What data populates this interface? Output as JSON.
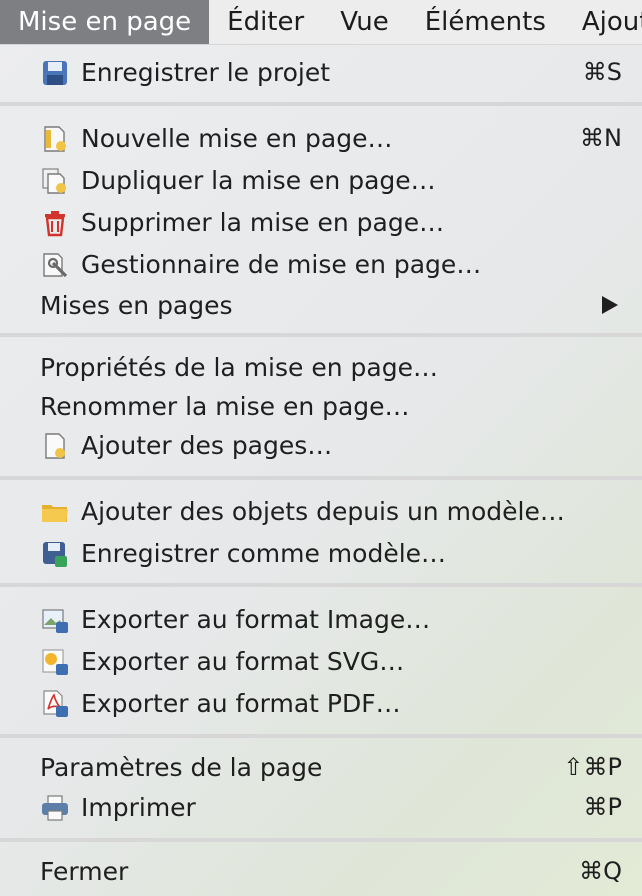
{
  "menubar": {
    "items": [
      "Mise en page",
      "Éditer",
      "Vue",
      "Éléments",
      "Ajout"
    ]
  },
  "menu": {
    "save_project": {
      "label": "Enregistrer le projet",
      "shortcut": "⌘S",
      "icon": "save-icon"
    },
    "new_layout": {
      "label": "Nouvelle mise en page…",
      "shortcut": "⌘N",
      "icon": "new-layout-icon"
    },
    "duplicate_layout": {
      "label": "Dupliquer la mise en page…",
      "icon": "duplicate-layout-icon"
    },
    "delete_layout": {
      "label": "Supprimer la mise en page…",
      "icon": "trash-icon"
    },
    "layout_manager": {
      "label": "Gestionnaire de mise en page…",
      "icon": "layout-manager-icon"
    },
    "layouts": {
      "label": "Mises en pages",
      "icon": "submenu-arrow-icon"
    },
    "layout_properties": {
      "label": "Propriétés de la mise en page…"
    },
    "rename_layout": {
      "label": "Renommer la mise en page…"
    },
    "add_pages": {
      "label": "Ajouter des pages…",
      "icon": "add-pages-icon"
    },
    "add_from_template": {
      "label": "Ajouter des objets depuis un modèle…",
      "icon": "folder-icon"
    },
    "save_as_template": {
      "label": "Enregistrer comme modèle…",
      "icon": "save-template-icon"
    },
    "export_image": {
      "label": "Exporter au format Image…",
      "icon": "export-image-icon"
    },
    "export_svg": {
      "label": "Exporter au format SVG…",
      "icon": "export-svg-icon"
    },
    "export_pdf": {
      "label": "Exporter au format PDF…",
      "icon": "export-pdf-icon"
    },
    "page_setup": {
      "label": "Paramètres de la page",
      "shortcut": "⇧⌘P"
    },
    "print": {
      "label": "Imprimer",
      "shortcut": "⌘P",
      "icon": "printer-icon"
    },
    "close": {
      "label": "Fermer",
      "shortcut": "⌘Q"
    }
  },
  "colors": {
    "active_menu_bg": "#7d7f83",
    "separator": "#d7d7d7",
    "trash_red": "#d0342c",
    "folder_yellow": "#f2c445"
  }
}
